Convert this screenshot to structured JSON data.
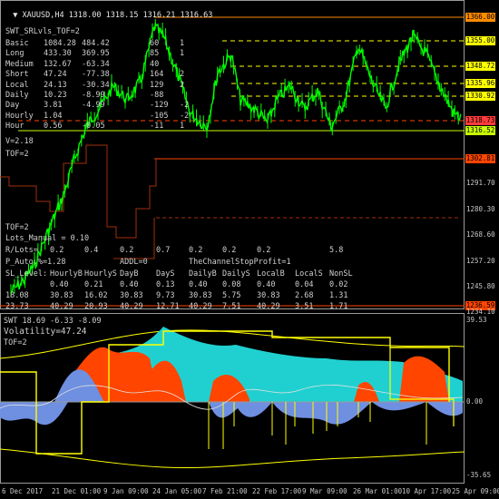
{
  "header": {
    "symbol_tf": "XAUUSD,H4",
    "ohlc": "1318.00 1318.15 1316.21 1316.63"
  },
  "top_panel": {
    "indicator_name": "SWT_SRLvls_TOF=2",
    "table_rows": [
      {
        "name": "Basic",
        "c1": "1084.28",
        "c2": "484.42",
        "c3": "60",
        "c4": "1"
      },
      {
        "name": "Long",
        "c1": "433.30",
        "c2": "369.95",
        "c3": "85",
        "c4": "1"
      },
      {
        "name": "Medium",
        "c1": "132.67",
        "c2": "-63.34",
        "c3": "40",
        "c4": ""
      },
      {
        "name": "Short",
        "c1": "47.24",
        "c2": "-77.38",
        "c3": "164",
        "c4": "2"
      },
      {
        "name": "Local",
        "c1": "24.13",
        "c2": "-30.34",
        "c3": "129",
        "c4": "2"
      },
      {
        "name": "Daily",
        "c1": "10.23",
        "c2": "-8.99",
        "c3": "-88",
        "c4": ""
      },
      {
        "name": "Day",
        "c1": "3.81",
        "c2": "-4.99",
        "c3": "-129",
        "c4": "-2"
      },
      {
        "name": "Hourly",
        "c1": "1.04",
        "c2": "",
        "c3": "-105",
        "c4": "-2"
      },
      {
        "name": "Hour",
        "c1": "0.56",
        "c2": "-0.05",
        "c3": "-11",
        "c4": "1"
      }
    ],
    "v_value": "V=2.18",
    "tof1": "TOF=2",
    "tof2": "TOF=2",
    "lots_manual": "Lots_Manual = 0.10",
    "rlots_label": "R/Lots=",
    "rlots_values": [
      "0.2",
      "0.4",
      "0.2",
      "0.7",
      "0.2",
      "0.2",
      "0.2",
      "5.8"
    ],
    "p_auto": "P_Auto,%=1.28",
    "addl": "ADDL=0",
    "channel_stop": "TheChannelStopProfit=1",
    "sl_header": [
      "SL_Level:",
      "HourlyB",
      "HourlyS",
      "DayB",
      "DayS",
      "DailyB",
      "DailyS",
      "LocalB",
      "LocalS",
      "NonSL"
    ],
    "sl_row1": [
      "",
      "0.40",
      "0.21",
      "0.40",
      "0.13",
      "0.40",
      "0.08",
      "0.40",
      "0.04",
      "0.02"
    ],
    "sl_row2": [
      "18.08",
      "30.83",
      "16.02",
      "30.83",
      "9.73",
      "30.83",
      "5.75",
      "30.83",
      "2.68",
      "1.31"
    ],
    "sl_row3": [
      "23.73",
      "40.29",
      "20.93",
      "40.29",
      "12.71",
      "40.29",
      "7.51",
      "40.29",
      "3.51",
      "1.71"
    ]
  },
  "price_labels": [
    {
      "text": "1366.00",
      "color": "#ff8c00"
    },
    {
      "text": "1355.00",
      "color": "#ffff00"
    },
    {
      "text": "1348.72",
      "color": "#ffff00"
    },
    {
      "text": "1335.96",
      "color": "#ffff00"
    },
    {
      "text": "1330.92",
      "color": "#ffff00"
    },
    {
      "text": "1318.73",
      "color": "#ff3c3c"
    },
    {
      "text": "1316.52",
      "color": "#c8ff00"
    },
    {
      "text": "1302.81",
      "color": "#ff4500"
    },
    {
      "text": "1236.59",
      "color": "#ff4500"
    }
  ],
  "price_axis": [
    "1291.70",
    "1280.30",
    "1268.60",
    "1257.20",
    "1245.80",
    "1234.10"
  ],
  "bottom_panel": {
    "indicator_line": "SWT 18.69 -6.33 -8.09",
    "volatility": "Volatility=47.24",
    "tof": "TOF=2",
    "axis_top": "39.53",
    "axis_zero": "0.00",
    "axis_bottom": "-35.65"
  },
  "time_axis": [
    "6 Dec 2017",
    "21 Dec 01:00",
    "9 Jan 09:00",
    "24 Jan 05:00",
    "7 Feb 21:00",
    "22 Feb 17:00",
    "9 Mar 09:00",
    "26 Mar 01:00",
    "10 Apr 17:00",
    "25 Apr 09:00"
  ],
  "colors": {
    "background": "#000000",
    "candles": "#00ff00",
    "resistance": "#ff8c00",
    "support_orange": "#ff4500",
    "level_yellow": "#ffff00",
    "osc_orange": "#ff4500",
    "osc_cyan": "#20d0d0",
    "osc_blue": "#6f8fe0",
    "osc_yellow": "#ffff00"
  }
}
